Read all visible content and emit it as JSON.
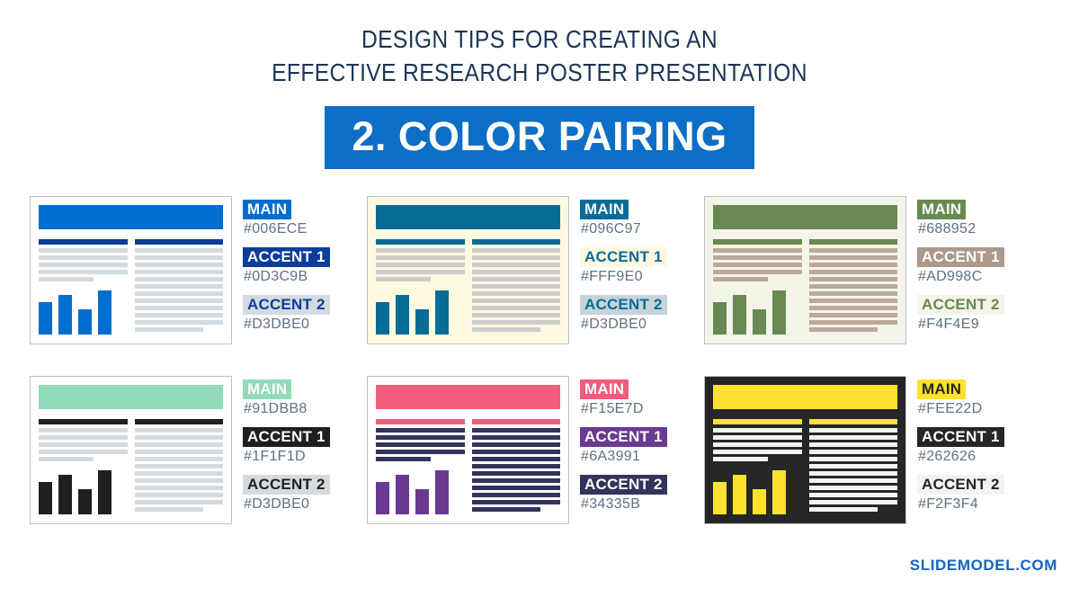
{
  "header": {
    "title_line1": "DESIGN TIPS FOR CREATING AN",
    "title_line2": "EFFECTIVE RESEARCH POSTER PRESENTATION",
    "banner_text": "2. COLOR PAIRING",
    "banner_bg": "#0D6EC6"
  },
  "footer": {
    "brand": "SLIDEMODEL.COM",
    "brand_color": "#1565C0"
  },
  "legend_labels": {
    "main": "MAIN",
    "accent1": "ACCENT 1",
    "accent2": "ACCENT 2"
  },
  "palettes": [
    {
      "name": "blue-palette",
      "main_label": "MAIN",
      "main_hex": "#006ECE",
      "accent1_label": "ACCENT 1",
      "accent1_hex": "#0D3C9B",
      "accent2_label": "ACCENT 2",
      "accent2_hex": "#D3DBE0",
      "main_chip_bg": "#006ECE",
      "main_chip_fg": "#FFFFFF",
      "accent1_chip_bg": "#0D3C9B",
      "accent1_chip_fg": "#FFFFFF",
      "accent2_chip_bg": "#D3DBE0",
      "accent2_chip_fg": "#0D3C9B",
      "poster_bg": "#FFFFFF",
      "poster_title_bg": "#006ECE",
      "poster_colhead_bg": "#0D3C9B",
      "poster_line_bg": "#D3DBE0",
      "poster_bar_bg": "#006ECE"
    },
    {
      "name": "teal-cream-palette",
      "main_label": "MAIN",
      "main_hex": "#096C97",
      "accent1_label": "ACCENT 1",
      "accent1_hex": "#FFF9E0",
      "accent2_label": "ACCENT 2",
      "accent2_hex": "#D3DBE0",
      "main_chip_bg": "#096C97",
      "main_chip_fg": "#FFFFFF",
      "accent1_chip_bg": "#FFF9E0",
      "accent1_chip_fg": "#096C97",
      "accent2_chip_bg": "#C7D2DA",
      "accent2_chip_fg": "#096C97",
      "poster_bg": "#FFF9E0",
      "poster_title_bg": "#096C97",
      "poster_colhead_bg": "#096C97",
      "poster_line_bg": "#CCCCCC",
      "poster_bar_bg": "#096C97"
    },
    {
      "name": "green-taupe-palette",
      "main_label": "MAIN",
      "main_hex": "#688952",
      "accent1_label": "ACCENT 1",
      "accent1_hex": "#AD998C",
      "accent2_label": "ACCENT 2",
      "accent2_hex": "#F4F4E9",
      "main_chip_bg": "#688952",
      "main_chip_fg": "#FFFFFF",
      "accent1_chip_bg": "#AD998C",
      "accent1_chip_fg": "#FFFFFF",
      "accent2_chip_bg": "#F4F4E9",
      "accent2_chip_fg": "#688952",
      "poster_bg": "#F4F4E9",
      "poster_title_bg": "#688952",
      "poster_colhead_bg": "#688952",
      "poster_line_bg": "#BCA99C",
      "poster_bar_bg": "#688952"
    },
    {
      "name": "mint-black-palette",
      "main_label": "MAIN",
      "main_hex": "#91DBB8",
      "accent1_label": "ACCENT 1",
      "accent1_hex": "#1F1F1D",
      "accent2_label": "ACCENT 2",
      "accent2_hex": "#D3DBE0",
      "main_chip_bg": "#91DBB8",
      "main_chip_fg": "#FFFFFF",
      "accent1_chip_bg": "#1F1F1D",
      "accent1_chip_fg": "#FFFFFF",
      "accent2_chip_bg": "#D3DBE0",
      "accent2_chip_fg": "#1F1F1D",
      "poster_bg": "#FFFFFF",
      "poster_title_bg": "#91DBB8",
      "poster_colhead_bg": "#1F1F1D",
      "poster_line_bg": "#D3DBE0",
      "poster_bar_bg": "#1F1F1D"
    },
    {
      "name": "pink-purple-palette",
      "main_label": "MAIN",
      "main_hex": "#F15E7D",
      "accent1_label": "ACCENT 1",
      "accent1_hex": "#6A3991",
      "accent2_label": "ACCENT 2",
      "accent2_hex": "#34335B",
      "main_chip_bg": "#F15E7D",
      "main_chip_fg": "#FFFFFF",
      "accent1_chip_bg": "#6A3991",
      "accent1_chip_fg": "#FFFFFF",
      "accent2_chip_bg": "#34335B",
      "accent2_chip_fg": "#FFFFFF",
      "poster_bg": "#FFFFFF",
      "poster_title_bg": "#F15E7D",
      "poster_colhead_bg": "#F15E7D",
      "poster_line_bg": "#34335B",
      "poster_bar_bg": "#6A3991"
    },
    {
      "name": "yellow-dark-palette",
      "main_label": "MAIN",
      "main_hex": "#FEE22D",
      "accent1_label": "ACCENT 1",
      "accent1_hex": "#262626",
      "accent2_label": "ACCENT 2",
      "accent2_hex": "#F2F3F4",
      "main_chip_bg": "#FEE22D",
      "main_chip_fg": "#262626",
      "accent1_chip_bg": "#262626",
      "accent1_chip_fg": "#FFFFFF",
      "accent2_chip_bg": "#F2F3F4",
      "accent2_chip_fg": "#262626",
      "poster_bg": "#262626",
      "poster_title_bg": "#FEE22D",
      "poster_colhead_bg": "#FEE22D",
      "poster_line_bg": "#F2F3F4",
      "poster_bar_bg": "#FEE22D"
    }
  ],
  "poster_mock": {
    "left_column_lines": 5,
    "right_column_lines": 12,
    "bar_heights_pct": [
      70,
      86,
      54,
      96
    ]
  }
}
